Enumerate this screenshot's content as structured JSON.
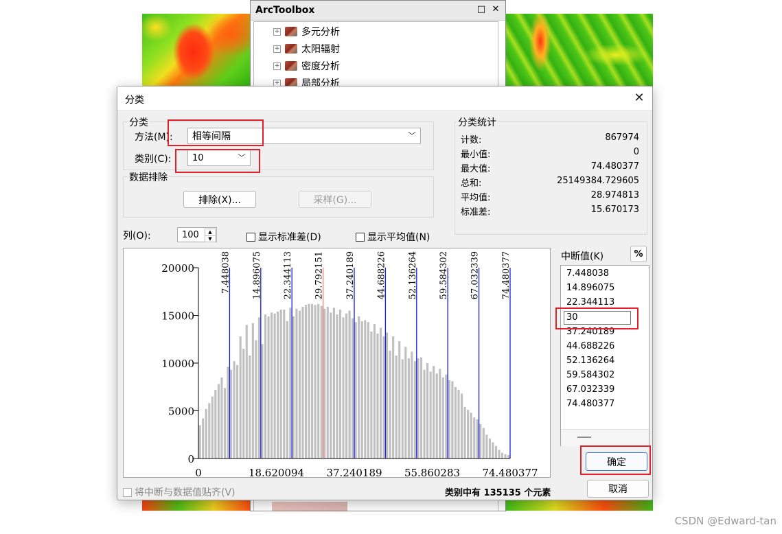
{
  "toolbox": {
    "title": "ArcToolbox",
    "minimize_glyph": "□",
    "close_glyph": "✕",
    "items": [
      {
        "label": "多元分析"
      },
      {
        "label": "太阳辐射"
      },
      {
        "label": "密度分析"
      },
      {
        "label": "局部分析"
      }
    ]
  },
  "dialog": {
    "title": "分类",
    "close_glyph": "✕",
    "classification": {
      "group_label": "分类",
      "method_label": "方法(M):",
      "method_value": "相等间隔",
      "classes_label": "类别(C):",
      "classes_value": "10"
    },
    "exclusion": {
      "group_label": "数据排除",
      "exclude_button": "排除(X)...",
      "sample_button": "采样(G)..."
    },
    "stats": {
      "group_label": "分类统计",
      "rows": [
        {
          "key": "计数:",
          "value": "867974"
        },
        {
          "key": "最小值:",
          "value": "0"
        },
        {
          "key": "最大值:",
          "value": "74.480377"
        },
        {
          "key": "总和:",
          "value": "25149384.729605"
        },
        {
          "key": "平均值:",
          "value": "28.974813"
        },
        {
          "key": "标准差:",
          "value": "15.670173"
        }
      ]
    },
    "columns_label": "列(O):",
    "columns_value": "100",
    "show_std_label": "显示标准差(D)",
    "show_mean_label": "显示平均值(N)",
    "breaks_label": "中断值(K)",
    "percent_button": "%",
    "breaks": [
      "7.448038",
      "14.896075",
      "22.344113",
      "30",
      "37.240189",
      "44.688226",
      "52.136264",
      "59.584302",
      "67.032339",
      "74.480377"
    ],
    "snap_label": "将中断与数据值贴齐(V)",
    "count_prefix": "类别中有",
    "count_value": "135135",
    "count_suffix": "个元素",
    "ok_button": "确定",
    "cancel_button": "取消"
  },
  "chart_data": {
    "type": "bar",
    "x_ticks": [
      "0",
      "18.620094",
      "37.240189",
      "55.860283",
      "74.480377"
    ],
    "y_ticks": [
      "0",
      "5000",
      "10000",
      "15000",
      "20000"
    ],
    "xlim": [
      0,
      74.480377
    ],
    "ylim": [
      0,
      20000
    ],
    "bin_count": 100,
    "break_labels": [
      "7.448038",
      "14.896075",
      "22.344113",
      "29.792151",
      "37.240189",
      "44.688226",
      "52.136264",
      "59.584302",
      "67.032339",
      "74.480377"
    ],
    "break_values": [
      7.448038,
      14.896075,
      22.344113,
      29.792151,
      37.240189,
      44.688226,
      52.136264,
      59.584302,
      67.032339,
      74.480377
    ],
    "selected_break_index": 3,
    "bins": [
      3500,
      4200,
      5200,
      5800,
      6500,
      7200,
      7800,
      8500,
      7400,
      9600,
      9300,
      10200,
      9800,
      12800,
      11500,
      14000,
      10800,
      14200,
      12400,
      14800,
      12000,
      15100,
      14900,
      15300,
      15200,
      15400,
      15600,
      15600,
      14400,
      15800,
      14900,
      15700,
      15500,
      15900,
      16100,
      16200,
      16200,
      16100,
      16200,
      16000,
      15700,
      15900,
      15300,
      15800,
      15100,
      15600,
      14800,
      15200,
      15500,
      14700,
      14300,
      14900,
      14400,
      14500,
      14300,
      13300,
      14100,
      13100,
      13700,
      12800,
      13200,
      11300,
      12800,
      10800,
      12300,
      10400,
      11700,
      10500,
      11200,
      10200,
      10500,
      10600,
      9300,
      10000,
      9100,
      9700,
      8900,
      9400,
      8500,
      8800,
      8200,
      8100,
      7500,
      7200,
      6800,
      5400,
      5100,
      4800,
      4300,
      4100,
      3600,
      3200,
      2500,
      2100,
      1700,
      1300,
      900,
      600,
      450,
      350
    ],
    "colors": {
      "bar": "#c0c0c0",
      "break": "#1a1ae6",
      "selected_break": "#f08080"
    }
  },
  "watermark": "CSDN @Edward-tan"
}
